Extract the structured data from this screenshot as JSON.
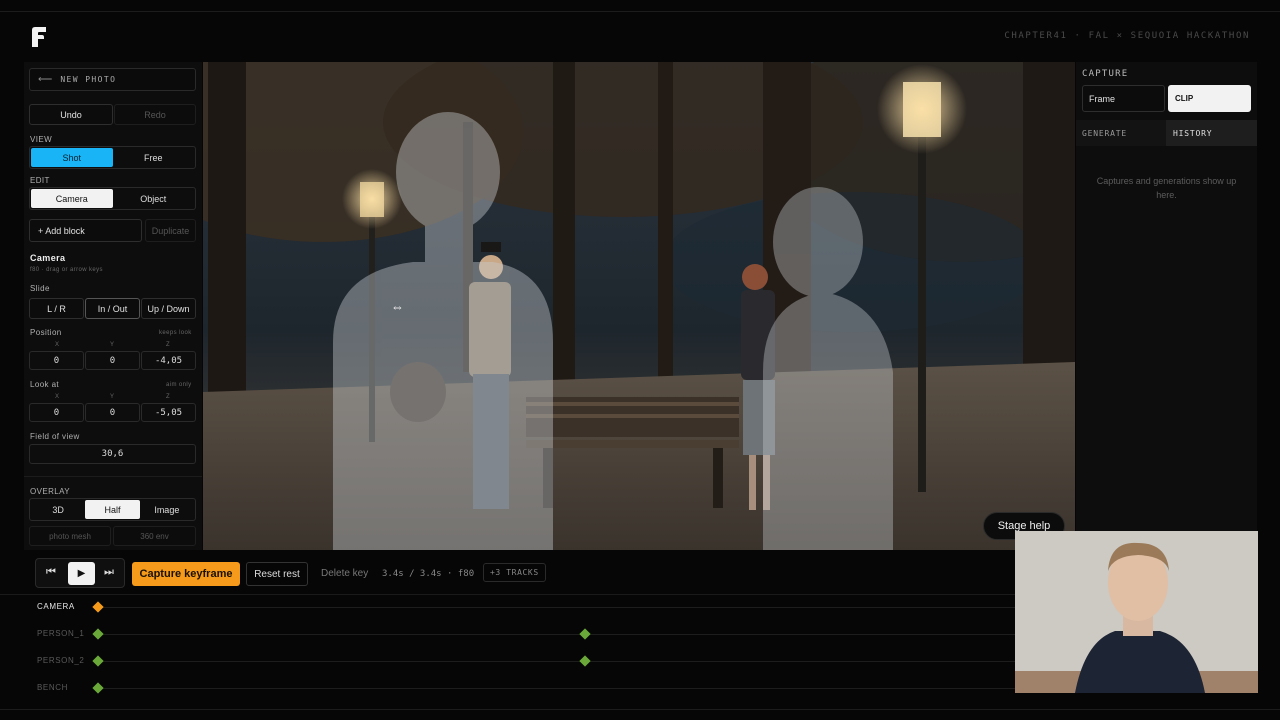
{
  "brand": {
    "header_text": "CHAPTER41 · FAL × SEQUOIA HACKATHON"
  },
  "left_panel": {
    "new_photo": "NEW PHOTO",
    "undo": "Undo",
    "redo": "Redo",
    "view_label": "VIEW",
    "view_options": [
      "Shot",
      "Free"
    ],
    "edit_label": "EDIT",
    "edit_options": [
      "Camera",
      "Object"
    ],
    "add_block": "+ Add block",
    "duplicate": "Duplicate",
    "camera_title": "Camera",
    "camera_hint": "f80 · drag or arrow keys",
    "slide_label": "Slide",
    "slide_options": [
      "L / R",
      "In / Out",
      "Up / Down"
    ],
    "position_label": "Position",
    "position_hint": "keeps look",
    "position": {
      "x": "0",
      "y": "0",
      "z": "-4,05"
    },
    "look_at_label": "Look at",
    "look_at_hint": "aim only",
    "look_at": {
      "x": "0",
      "y": "0",
      "z": "-5,05"
    },
    "axes": {
      "x": "X",
      "y": "Y",
      "z": "Z"
    },
    "fov_label": "Field of view",
    "fov_value": "30,6",
    "overlay_label": "OVERLAY",
    "overlay_options": [
      "3D",
      "Half",
      "Image"
    ],
    "photo_mesh": "photo mesh",
    "env_360": "360 env"
  },
  "right_panel": {
    "capture_label": "CAPTURE",
    "frame": "Frame",
    "clip": "CLIP",
    "tab_generate": "GENERATE",
    "tab_history": "HISTORY",
    "empty_text": "Captures and generations show up here."
  },
  "stage_help": "Stage help",
  "timeline": {
    "capture_keyframe": "Capture keyframe",
    "reset_rest": "Reset rest",
    "delete_key": "Delete key",
    "time_readout": "3.4s / 3.4s · f80",
    "tracks_badge": "+3 TRACKS",
    "rows": [
      {
        "label": "CAMERA",
        "keys": [
          0.0
        ]
      },
      {
        "label": "PERSON_1",
        "keys": [
          0.0,
          0.531
        ]
      },
      {
        "label": "PERSON_2",
        "keys": [
          0.0,
          0.531
        ]
      },
      {
        "label": "BENCH",
        "keys": [
          0.0
        ]
      }
    ]
  },
  "colors": {
    "accent_orange": "#f59a1b",
    "accent_blue": "#18b4f5",
    "key_green": "#6aa83a"
  }
}
